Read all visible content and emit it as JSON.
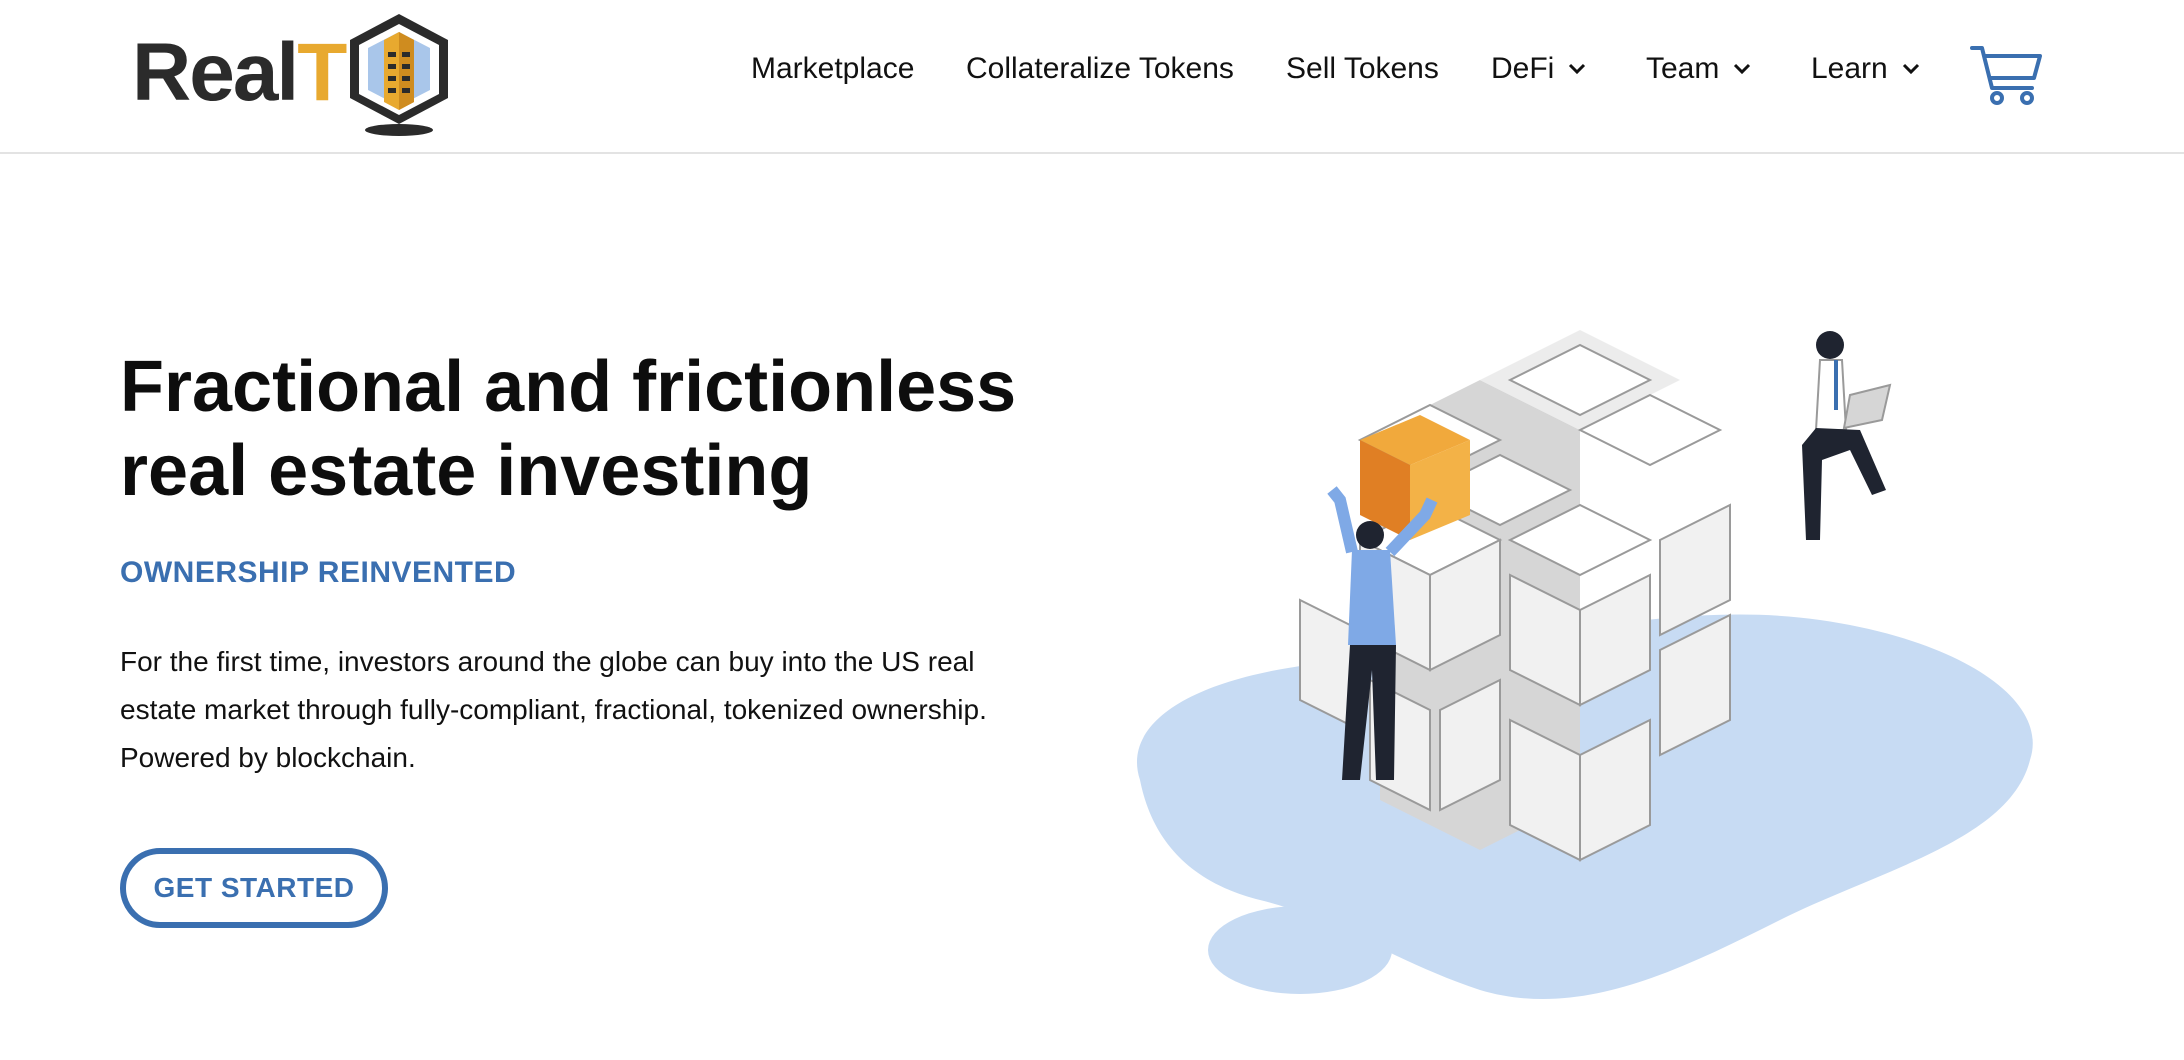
{
  "brand": {
    "name_main": "Real",
    "name_accent": "T"
  },
  "nav": {
    "items": [
      {
        "label": "Marketplace",
        "dropdown": false
      },
      {
        "label": "Collateralize Tokens",
        "dropdown": false
      },
      {
        "label": "Sell Tokens",
        "dropdown": false
      },
      {
        "label": "DeFi",
        "dropdown": true
      },
      {
        "label": "Team",
        "dropdown": true
      },
      {
        "label": "Learn",
        "dropdown": true
      }
    ],
    "cart_icon": "cart-icon"
  },
  "hero": {
    "title_line1": "Fractional and frictionless",
    "title_line2": "real estate investing",
    "subtitle": "OWNERSHIP REINVENTED",
    "body_line1": "For the first time, investors around the globe can buy into the US real",
    "body_line2": "estate market through fully-compliant, fractional, tokenized ownership.",
    "body_line3": "Powered by blockchain.",
    "cta_label": "GET STARTED"
  },
  "colors": {
    "accent_blue": "#3a6fb0",
    "brand_gold": "#e8a92f",
    "blob_blue": "#c7dbf3",
    "text_dark": "#111111"
  }
}
